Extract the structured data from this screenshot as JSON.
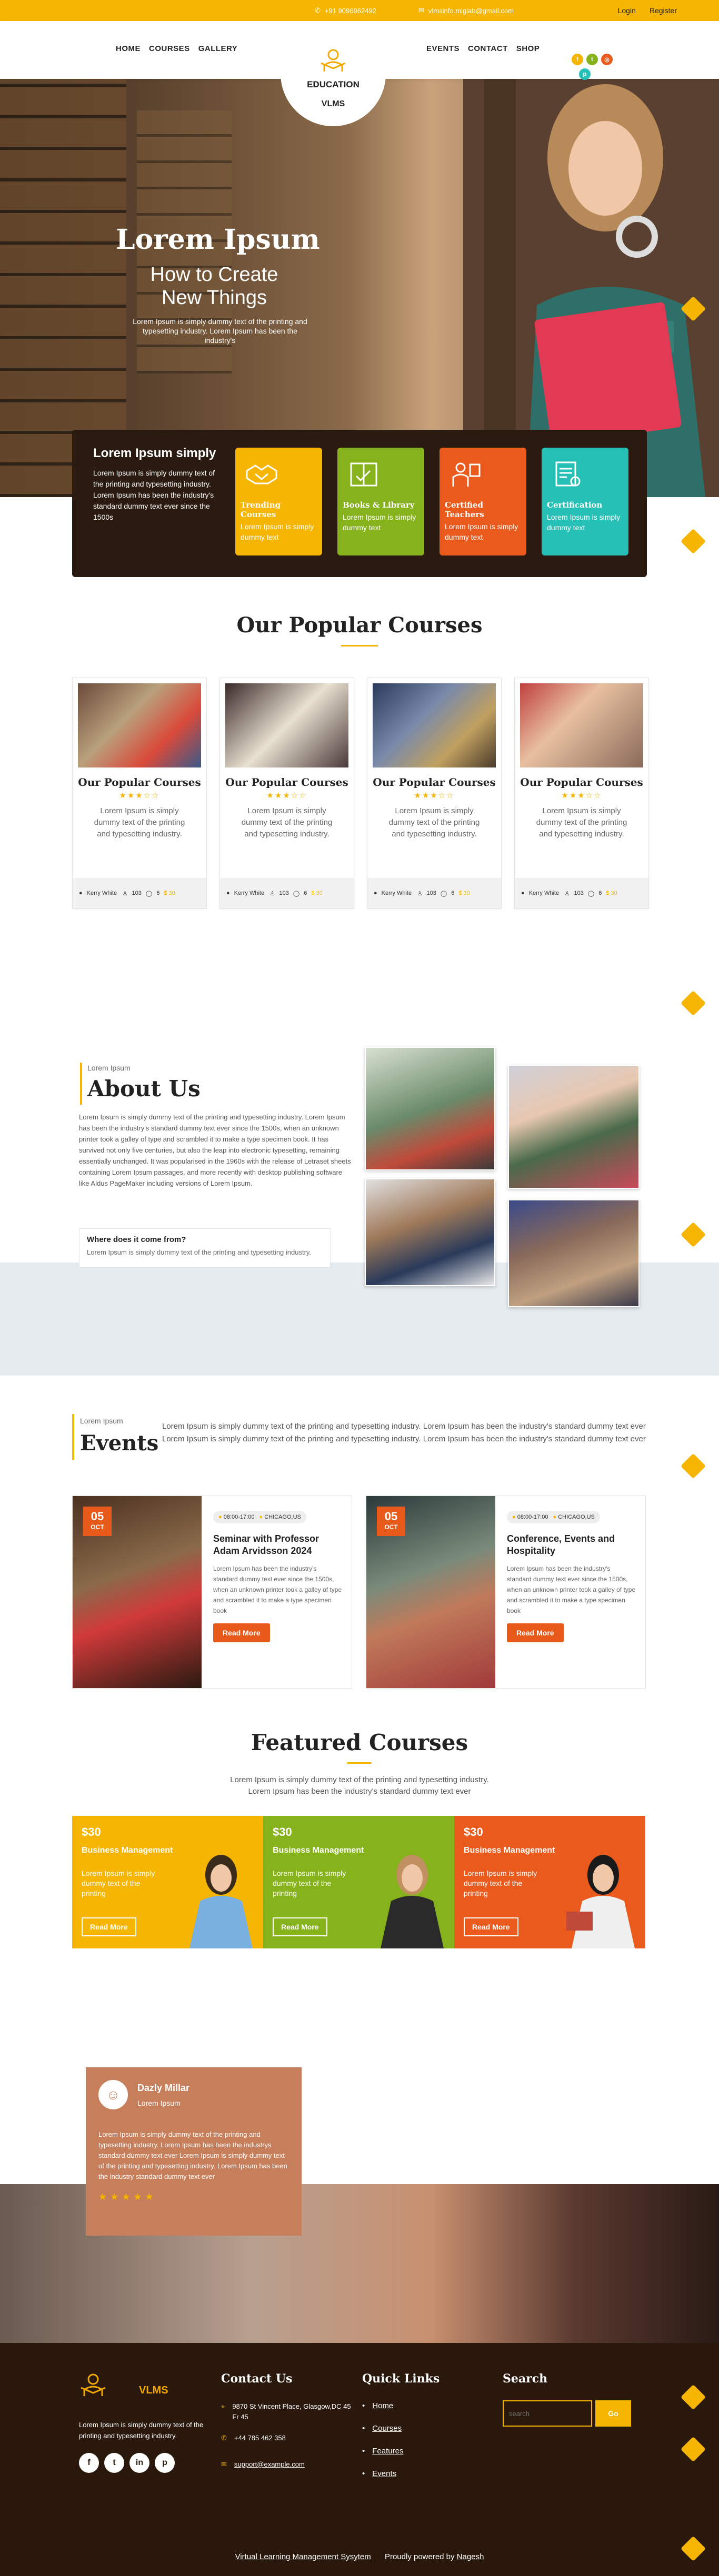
{
  "topbar": {
    "phone": "+91 9096962492",
    "email": "vlmsinfo.miglab@gmail.com",
    "login": "Login",
    "register": "Register"
  },
  "nav": {
    "left": [
      "HOME",
      "COURSES",
      "GALLERY"
    ],
    "right": [
      "EVENTS",
      "CONTACT",
      "SHOP"
    ],
    "logo_line1": "EDUCATION",
    "logo_line2": "VLMS"
  },
  "hero": {
    "title": "Lorem Ipsum",
    "subtitle": "How to Create New Things",
    "text": "Lorem Ipsum is simply dummy text of the printing and typesetting industry. Lorem Ipsum has been the industry's"
  },
  "features": {
    "title": "Lorem Ipsum simply",
    "text": "Lorem Ipsum is simply dummy text of the printing and typesetting industry. Lorem Ipsum has been the industry's standard dummy text ever since the 1500s",
    "cards": [
      {
        "title": "Trending Courses",
        "text": "Lorem Ipsum is simply dummy text",
        "color": "#f6b500",
        "icon": "handshake-icon"
      },
      {
        "title": "Books & Library",
        "text": "Lorem Ipsum is simply dummy text",
        "color": "#86b31b",
        "icon": "book-icon"
      },
      {
        "title": "Certified Teachers",
        "text": "Lorem Ipsum is simply dummy text",
        "color": "#ea5a1c",
        "icon": "teacher-icon"
      },
      {
        "title": "Certification",
        "text": "Lorem Ipsum is simply dummy text",
        "color": "#27c0b6",
        "icon": "certificate-icon"
      }
    ]
  },
  "popular": {
    "heading": "Our Popular Courses",
    "courses": [
      {
        "title": "Our Popular Courses",
        "text": "Lorem Ipsum is simply dummy text of the printing and typesetting industry.",
        "author": "Kerry White",
        "students": "103",
        "comments": "6",
        "price": "$ 30",
        "rating": 3
      },
      {
        "title": "Our Popular Courses",
        "text": "Lorem Ipsum is simply dummy text of the printing and typesetting industry.",
        "author": "Kerry White",
        "students": "103",
        "comments": "6",
        "price": "$ 30",
        "rating": 3
      },
      {
        "title": "Our Popular Courses",
        "text": "Lorem Ipsum is simply dummy text of the printing and typesetting industry.",
        "author": "Kerry White",
        "students": "103",
        "comments": "6",
        "price": "$ 30",
        "rating": 3
      },
      {
        "title": "Our Popular Courses",
        "text": "Lorem Ipsum is simply dummy text of the printing and typesetting industry.",
        "author": "Kerry White",
        "students": "103",
        "comments": "6",
        "price": "$ 30",
        "rating": 3
      }
    ]
  },
  "about": {
    "kicker": "Lorem Ipsum",
    "heading": "About Us",
    "text": "Lorem Ipsum is simply dummy text of the printing and typesetting industry. Lorem Ipsum has been the industry's standard dummy text ever since the 1500s, when an unknown printer took a galley of type and scrambled it to make a type specimen book. It has survived not only five centuries, but also the leap into electronic typesetting, remaining essentially unchanged. It was popularised in the 1960s with the release of Letraset sheets containing Lorem Ipsum passages, and more recently with desktop publishing software like Aldus PageMaker including versions of Lorem Ipsum.",
    "box_title": "Where does it come from?",
    "box_text": "Lorem Ipsum is simply dummy text of the printing and typesetting industry."
  },
  "events": {
    "kicker": "Lorem Ipsum",
    "heading": "Events",
    "intro": "Lorem Ipsum is simply dummy text of the printing and typesetting industry. Lorem Ipsum has been the industry's standard dummy text ever Lorem Ipsum is simply dummy text of the printing and typesetting industry. Lorem Ipsum has been the industry's standard dummy text ever",
    "items": [
      {
        "day": "05",
        "month": "OCT",
        "time": "08:00-17:00",
        "place": "CHICAGO,US",
        "title": "Seminar with Professor Adam Arvidsson 2024",
        "text": "Lorem Ipsum has been the industry's standard dummy text ever since the 1500s, when an unknown printer took a galley of type and scrambled it to make a type specimen book",
        "button": "Read More"
      },
      {
        "day": "05",
        "month": "OCT",
        "time": "08:00-17:00",
        "place": "CHICAGO,US",
        "title": "Conference, Events and Hospitality",
        "text": "Lorem Ipsum has been the industry's standard dummy text ever since the 1500s, when an unknown printer took a galley of type and scrambled it to make a type specimen book",
        "button": "Read More"
      }
    ]
  },
  "featured": {
    "heading": "Featured Courses",
    "intro": "Lorem Ipsum is simply dummy text of the printing and typesetting industry. Lorem Ipsum has been the industry's standard dummy text ever",
    "cards": [
      {
        "price": "$30",
        "title": "Business Management",
        "text": "Lorem Ipsum is simply dummy text of the printing",
        "button": "Read More",
        "color": "#f6b500"
      },
      {
        "price": "$30",
        "title": "Business Management",
        "text": "Lorem Ipsum is simply dummy text of the printing",
        "button": "Read More",
        "color": "#86b31b"
      },
      {
        "price": "$30",
        "title": "Business Management",
        "text": "Lorem Ipsum is simply dummy text of the printing",
        "button": "Read More",
        "color": "#ea5a1c"
      }
    ]
  },
  "testimonial": {
    "name": "Dazly Millar",
    "role": "Lorem Ipsum",
    "text": "Lorem Ipsum is simply dummy text of the printing and typesetting industry. Lorem Ipsum has been the industrys standard dummy text ever Lorem Ipsum is simply dummy text of the printing and typesetting industry. Lorem Ipsum has been the industry standard dummy text ever",
    "stars": "★★★★★"
  },
  "footer": {
    "brand": "VLMS",
    "about": "Lorem Ipsum is simply dummy text of the printing and typesetting industry.",
    "contact_heading": "Contact Us",
    "address": "9870 St Vincent Place, Glasgow,DC 45 Fr 45",
    "phone": "+44 785 462 358",
    "email": "support@example.com",
    "links_heading": "Quick Links",
    "links": [
      "Home",
      "Courses",
      "Features",
      "Events"
    ],
    "search_heading": "Search",
    "search_placeholder": "search",
    "search_button": "Go",
    "copyright_left": "Virtual Learning Management Sysytem",
    "copyright_mid": "Proudly powered by",
    "copyright_link": "Nagesh"
  }
}
